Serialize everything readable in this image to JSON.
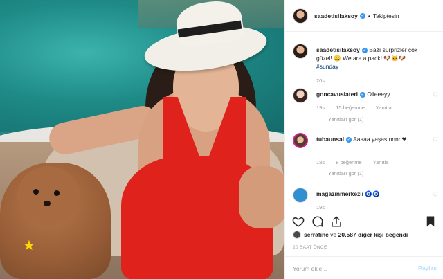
{
  "header": {
    "username": "saadetisilaksoy",
    "separator": "•",
    "follow_label": "Takiptesin"
  },
  "caption": {
    "username": "saadetisilaksoy",
    "text": "Bazı sürprizler çok güzel! 😃 We are a pack! 🐶🐱🐶",
    "hashtag": "#sunday",
    "time": "20s"
  },
  "comments": [
    {
      "username": "goncavuslateri",
      "text": "Olleeeyy",
      "time": "19s",
      "likes": "15 beğenme",
      "reply_label": "Yanıtla",
      "view_replies": "Yanıtları gör (1)"
    },
    {
      "username": "tubaunsal",
      "text": "Aaaaa yaşasınnnn❤",
      "time": "18s",
      "likes": "8 beğenme",
      "reply_label": "Yanıtla",
      "view_replies": "Yanıtları gör (1)"
    },
    {
      "username": "magazinmerkezii",
      "text": "🧿🧿",
      "time": "19s"
    }
  ],
  "likes": {
    "liker": "serrafine",
    "connector": "ve",
    "count": "20.587",
    "rest": "diğer kişi beğendi"
  },
  "timestamp": "20 SAAT ÖNCE",
  "add_comment": {
    "placeholder": "Yorum ekle...",
    "post_label": "Paylaş"
  },
  "icons": {
    "verified": "verified-badge-icon",
    "like": "heart-icon",
    "comment": "comment-icon",
    "share": "share-icon",
    "save": "bookmark-icon",
    "sticker": "star-icon"
  },
  "colors": {
    "verified": "#3897f0",
    "swimsuit": "#e0221c",
    "post_button_disabled": "#b2dffc"
  }
}
